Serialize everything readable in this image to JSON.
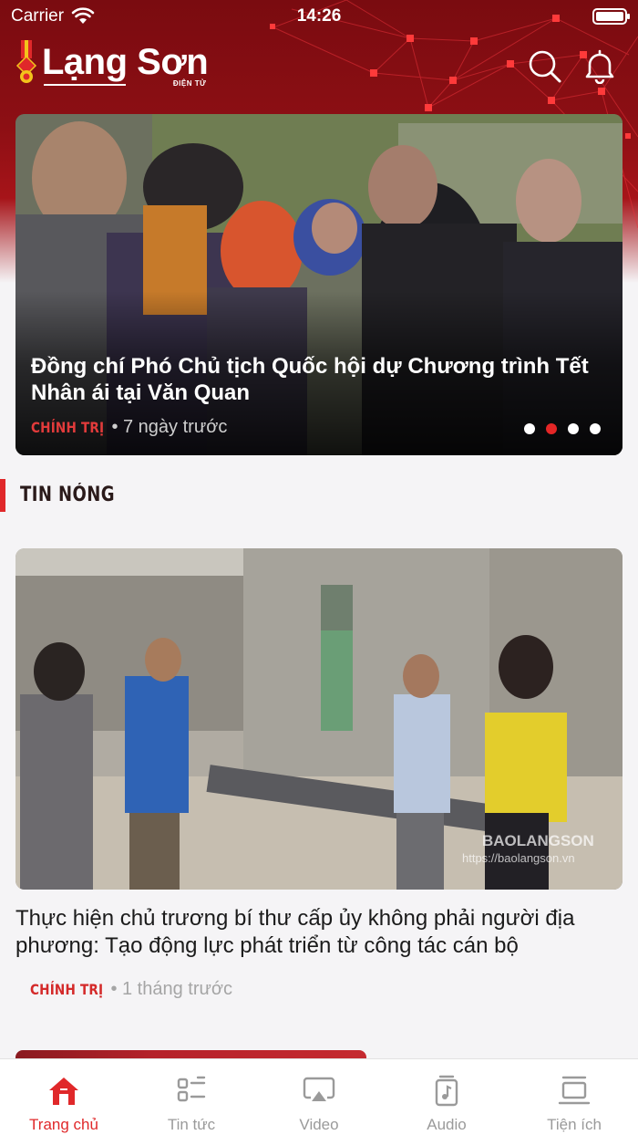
{
  "status_bar": {
    "carrier": "Carrier",
    "time": "14:26"
  },
  "app": {
    "logo_name": "Lạng Sơn",
    "logo_sub": "ĐIỆN TỬ"
  },
  "colors": {
    "accent": "#e0282a",
    "header": "#8d0f14",
    "inactive": "#9a9a9a"
  },
  "hero": {
    "title": "Đồng chí Phó Chủ tịch Quốc hội dự Chương trình Tết Nhân ái tại Văn Quan",
    "category": "CHÍNH TRỊ",
    "time": "• 7 ngày trước",
    "pager": {
      "count": 4,
      "active_index": 1
    }
  },
  "section": {
    "title": "TIN NÓNG"
  },
  "article": {
    "title": "Thực hiện chủ trương bí thư cấp ủy không phải người địa phương: Tạo động lực phát triển từ công tác cán bộ",
    "category": "CHÍNH TRỊ",
    "time": "• 1 tháng trước",
    "watermark": "BAOLANGSON",
    "watermark_url": "https://baolangson.vn"
  },
  "tabs": [
    {
      "label": "Trang chủ",
      "icon": "home-icon",
      "active": true
    },
    {
      "label": "Tin tức",
      "icon": "list-icon",
      "active": false
    },
    {
      "label": "Video",
      "icon": "video-icon",
      "active": false
    },
    {
      "label": "Audio",
      "icon": "audio-icon",
      "active": false
    },
    {
      "label": "Tiện ích",
      "icon": "utilities-icon",
      "active": false
    }
  ]
}
